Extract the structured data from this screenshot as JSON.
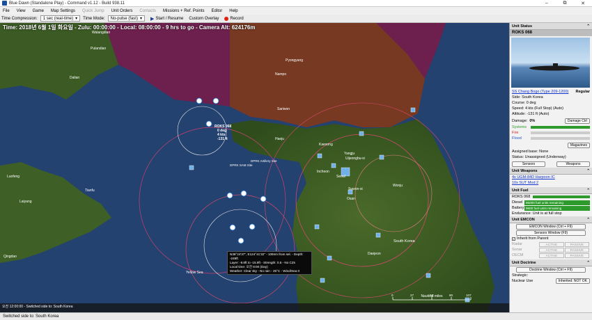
{
  "window": {
    "title": "Blue Dawn (Standalone Play) - Command v1.12 - Build 938.11",
    "controls": [
      "–",
      "⧉",
      "✕"
    ]
  },
  "menu": {
    "items": [
      "File",
      "View",
      "Game",
      "Map Settings",
      "Quick Jump",
      "Unit Orders",
      "Contacts",
      "Missions + Ref. Points",
      "Editor",
      "Help"
    ]
  },
  "toolbar": {
    "time_compression_label": "Time Compression:",
    "time_compression_value": "1 sec (real-time)",
    "time_mode_label": "Time Mode:",
    "time_mode_value": "No-pulse (fast)",
    "start_resume": "Start / Resume",
    "custom_overlay": "Custom Overlay",
    "record": "Record"
  },
  "map": {
    "time_readout": "Time: 2018년 6월 1일 화요일 - Zulu: 00:00:00 - Local: 08:00:00 - 9 hrs to go - Camera Alt: 624176m",
    "labels": {
      "walangdian": "Walangdian",
      "pulandian": "Pulandian",
      "dalian": "Dalian",
      "pyongyang": "Pyongyang",
      "nampo": "Nampo",
      "haeju": "Haeju",
      "sariwon": "Sariwon",
      "seoul": "Seoul",
      "incheon": "Incheon",
      "kaesong": "Kaesong",
      "yangju": "Yangju",
      "uijeongbu": "Uijeongbu-si",
      "suwon": "Suwon-si",
      "wonju": "Wonju",
      "osan": "Osan",
      "daejeon": "Daejeon",
      "south_korea": "South Korea",
      "yellow_sea": "Yellow Sea",
      "laiyang": "Laiyang",
      "laifeng": "Luofeng",
      "tianfu": "Tianfu",
      "qingdao": "Qingdao",
      "rizhao": "Rizhao",
      "unit_label": "ROKS 068",
      "unit_course": "0 deg",
      "unit_speed": "4 kts",
      "unit_alt": "-131 ft",
      "artillery": "DPRK Artillery Site",
      "dprk_sam": "DPRK SAM Site"
    },
    "tooltip": [
      "N36°24'37\", E124°41'32\" - 109nm from sel. - Depth: -249ft",
      "Layer: -9.8ft to -15.9ft - Strength: 0.5 - No CZs",
      "Local time: 오전 8:00 (Day)",
      "Weather: Clear sky - No rain - 25°C - Wind/Sea 0"
    ],
    "message": "오전 12:00:00 - Switched side to: South Korea",
    "scale": {
      "ticks": [
        "0",
        "27",
        "53",
        "80",
        "107"
      ],
      "unit": "Nautical miles"
    }
  },
  "status_bar": "Switched side to: South Korea",
  "panel": {
    "unit_status_title": "Unit Status",
    "unit_name": "ROKS 068",
    "class_link": "SS Chang Bogo (Type 209-1200)",
    "proficiency": "Regular",
    "side": "Side: South Korea",
    "course": "Course: 0 deg",
    "speed": "Speed: 4 kts (Full Stop)   (Auto)",
    "altitude": "Altitude: -131 ft   (Auto)",
    "damage_label": "Damage:",
    "damage_value": "0%",
    "damage_ctrl": "Damage Ctrl",
    "systems": "Systems",
    "fire": "Fire",
    "flood": "Flood",
    "systems_level": 1.0,
    "fire_level": 0.0,
    "flood_level": 0.0,
    "magazines": "Magazines",
    "assigned_base": "Assigned base: None",
    "status": "Status: Unassigned (Underway)",
    "sensors_btn": "Sensors",
    "weapons_btn": "Weapons",
    "unit_weapons_title": "Unit Weapons",
    "weapons": [
      "4x UGM-84D Harpoon IC",
      "10x SUT Mod 2"
    ],
    "unit_fuel_title": "Unit Fuel",
    "fuel_unit": "ROKS 068",
    "diesel_label": "Diesel",
    "diesel_value": "85000 fuel units remaining",
    "battery_label": "Battery",
    "battery_value": "9600 fuel units remaining",
    "endurance": "Endurance: Unit is at full stop",
    "unit_emcon_title": "Unit EMCON",
    "emcon_window_btn": "EMCON Window (Ctrl + F9)",
    "sensors_window_btn": "Sensors Window (F9)",
    "inherit_label": "Inherit from Parent",
    "emcon_rows": [
      {
        "label": "Radar",
        "active": "ACTIVE",
        "passive": "PASSIVE"
      },
      {
        "label": "Sonar",
        "active": "ACTIVE",
        "passive": "PASSIVE"
      },
      {
        "label": "OECM",
        "active": "ACTIVE",
        "passive": "PASSIVE"
      }
    ],
    "unit_doctrine_title": "Unit Doctrine",
    "doctrine_window_btn": "Doctrine Window (Ctrl + F9)",
    "strategic_label": "Strategic:",
    "nuclear_label": "Nuclear Use",
    "nuclear_value": "Inherited: NOT OK",
    "collapse_icon": "⌃"
  },
  "colors": {
    "sea": "#22406c",
    "land_green": "#3b5e22",
    "dprk_overlay": "#8a3a1e",
    "china_overlay": "#7a1a48",
    "fuel_green": "#2c9b2c"
  }
}
